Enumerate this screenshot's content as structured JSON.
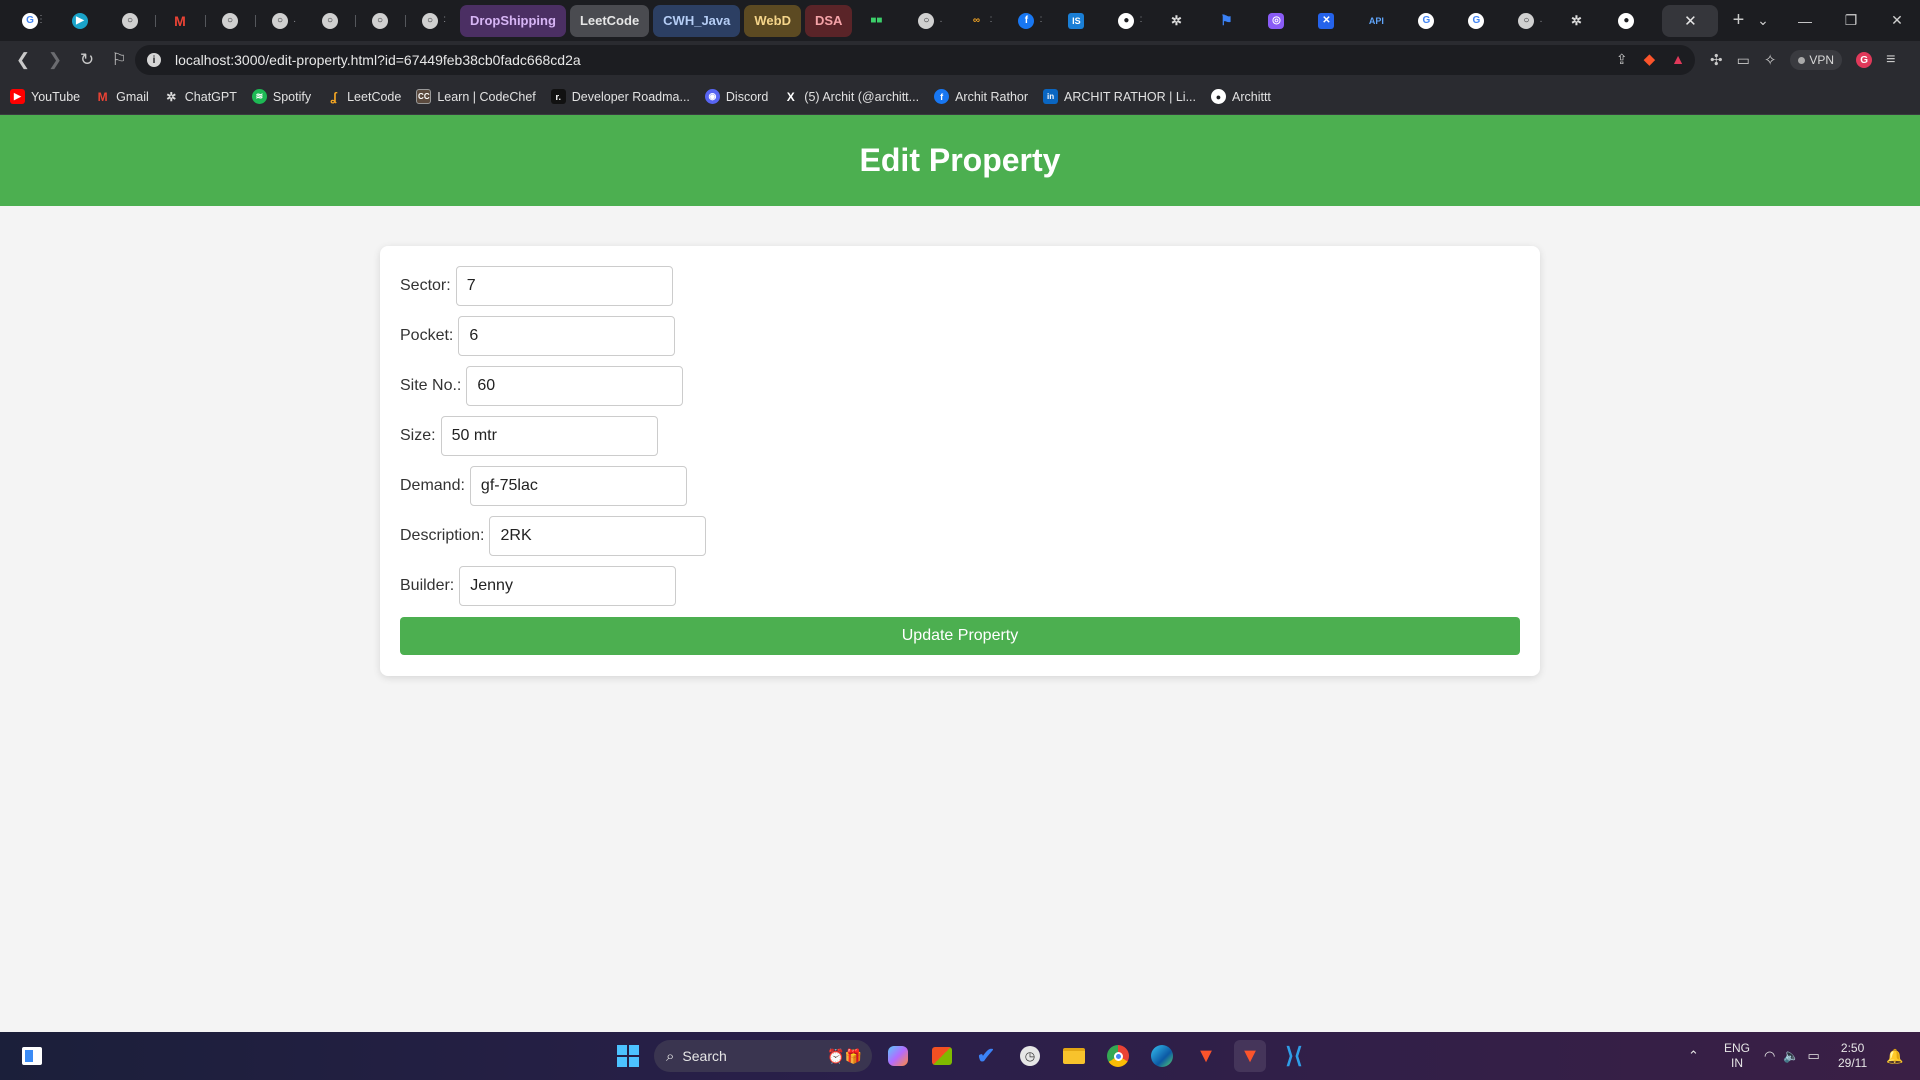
{
  "browser": {
    "tab_groups": [
      {
        "label": "DropShipping",
        "bg": "#4b2f63",
        "fg": "#d7b5f5"
      },
      {
        "label": "LeetCode",
        "bg": "#4a4b50",
        "fg": "#e6e6e6"
      },
      {
        "label": "CWH_Java",
        "bg": "#2c3f63",
        "fg": "#b5cdf5"
      },
      {
        "label": "WebD",
        "bg": "#5c4a22",
        "fg": "#f5d58a"
      },
      {
        "label": "DSA",
        "bg": "#5a2428",
        "fg": "#f5a3a8"
      }
    ],
    "active_tab_close": "✕",
    "new_tab": "+",
    "url": "localhost:3000/edit-property.html?id=67449feb38cb0fadc668cd2a",
    "vpn_label": "VPN",
    "bookmarks": [
      {
        "label": "YouTube",
        "icon": "youtube-icon",
        "color": "#ff0000",
        "glyph": "▶"
      },
      {
        "label": "Gmail",
        "icon": "gmail-icon",
        "color": "#ea4335",
        "glyph": "M"
      },
      {
        "label": "ChatGPT",
        "icon": "chatgpt-icon",
        "color": "#555",
        "glyph": "✲"
      },
      {
        "label": "Spotify",
        "icon": "spotify-icon",
        "color": "#1db954",
        "glyph": "≋"
      },
      {
        "label": "LeetCode",
        "icon": "leetcode-icon",
        "color": "#b07219",
        "glyph": "L"
      },
      {
        "label": "Learn | CodeChef",
        "icon": "codechef-icon",
        "color": "#6b4b3a",
        "glyph": "C"
      },
      {
        "label": "Developer Roadma...",
        "icon": "roadmap-icon",
        "color": "#222",
        "glyph": "r"
      },
      {
        "label": "Discord",
        "icon": "discord-icon",
        "color": "#5865f2",
        "glyph": "◉"
      },
      {
        "label": "(5) Archit (@architt...",
        "icon": "x-twitter-icon",
        "color": "#000",
        "glyph": "X"
      },
      {
        "label": "Archit Rathor",
        "icon": "facebook-icon",
        "color": "#1877f2",
        "glyph": "f"
      },
      {
        "label": "ARCHIT RATHOR | Li...",
        "icon": "linkedin-icon",
        "color": "#0a66c2",
        "glyph": "in"
      },
      {
        "label": "Archittt",
        "icon": "github-icon",
        "color": "#333",
        "glyph": "●"
      }
    ]
  },
  "page": {
    "title": "Edit Property",
    "fields": [
      {
        "label": "Sector:",
        "value": "7"
      },
      {
        "label": "Pocket:",
        "value": "6"
      },
      {
        "label": "Site No.:",
        "value": "60"
      },
      {
        "label": "Size:",
        "value": "50 mtr"
      },
      {
        "label": "Demand:",
        "value": "gf-75lac"
      },
      {
        "label": "Description:",
        "value": "2RK"
      },
      {
        "label": "Builder:",
        "value": "Jenny"
      }
    ],
    "submit_label": "Update Property",
    "accent": "#4caf50"
  },
  "taskbar": {
    "search_label": "Search",
    "lang_line1": "ENG",
    "lang_line2": "IN",
    "time": "2:50",
    "date": "29/11"
  }
}
